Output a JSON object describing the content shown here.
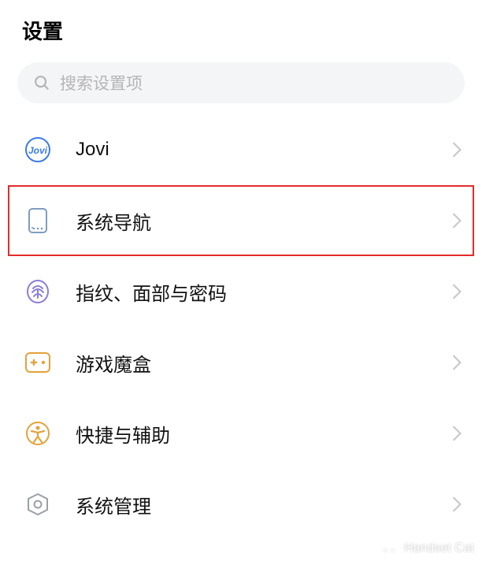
{
  "header": {
    "title": "设置"
  },
  "search": {
    "placeholder": "搜索设置项"
  },
  "list": {
    "items": [
      {
        "label": "Jovi",
        "icon": "jovi-icon",
        "highlight": false
      },
      {
        "label": "系统导航",
        "icon": "phone-nav-icon",
        "highlight": true
      },
      {
        "label": "指纹、面部与密码",
        "icon": "fingerprint-icon",
        "highlight": false
      },
      {
        "label": "游戏魔盒",
        "icon": "game-box-icon",
        "highlight": false
      },
      {
        "label": "快捷与辅助",
        "icon": "accessibility-icon",
        "highlight": false
      },
      {
        "label": "系统管理",
        "icon": "system-mgmt-icon",
        "highlight": false
      }
    ]
  },
  "watermark": {
    "text": "Handset Cat"
  }
}
